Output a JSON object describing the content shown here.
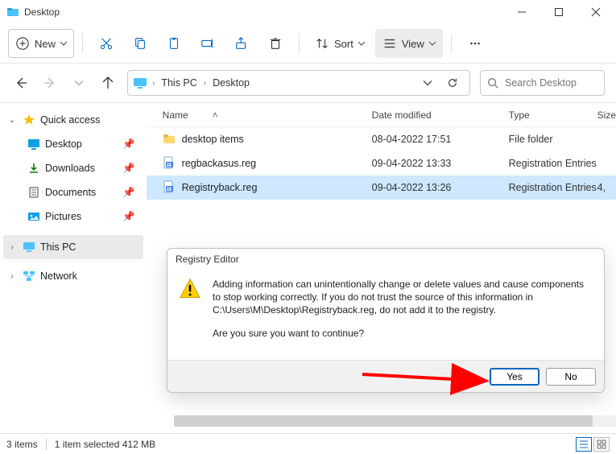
{
  "window": {
    "title": "Desktop"
  },
  "toolbar": {
    "new_label": "New",
    "sort_label": "Sort",
    "view_label": "View"
  },
  "breadcrumb": {
    "segments": [
      "This PC",
      "Desktop"
    ]
  },
  "search": {
    "placeholder": "Search Desktop"
  },
  "sidebar": {
    "quick_access": "Quick access",
    "items": [
      {
        "label": "Desktop"
      },
      {
        "label": "Downloads"
      },
      {
        "label": "Documents"
      },
      {
        "label": "Pictures"
      }
    ],
    "this_pc": "This PC",
    "network": "Network"
  },
  "columns": {
    "name": "Name",
    "date": "Date modified",
    "type": "Type",
    "size": "Size"
  },
  "files": [
    {
      "name": "desktop items",
      "date": "08-04-2022 17:51",
      "type": "File folder",
      "size": "",
      "selected": false,
      "icon": "folder"
    },
    {
      "name": "regbackasus.reg",
      "date": "09-04-2022 13:33",
      "type": "Registration Entries",
      "size": "",
      "selected": false,
      "icon": "reg"
    },
    {
      "name": "Registryback.reg",
      "date": "09-04-2022 13:26",
      "type": "Registration Entries",
      "size": "4,",
      "selected": true,
      "icon": "reg"
    }
  ],
  "dialog": {
    "title": "Registry Editor",
    "line1": "Adding information can unintentionally change or delete values and cause components to stop working correctly. If you do not trust the source of this information in C:\\Users\\M\\Desktop\\Registryback.reg, do not add it to the registry.",
    "line2": "Are you sure you want to continue?",
    "yes": "Yes",
    "no": "No"
  },
  "status": {
    "count": "3 items",
    "selection": "1 item selected  412 MB"
  }
}
